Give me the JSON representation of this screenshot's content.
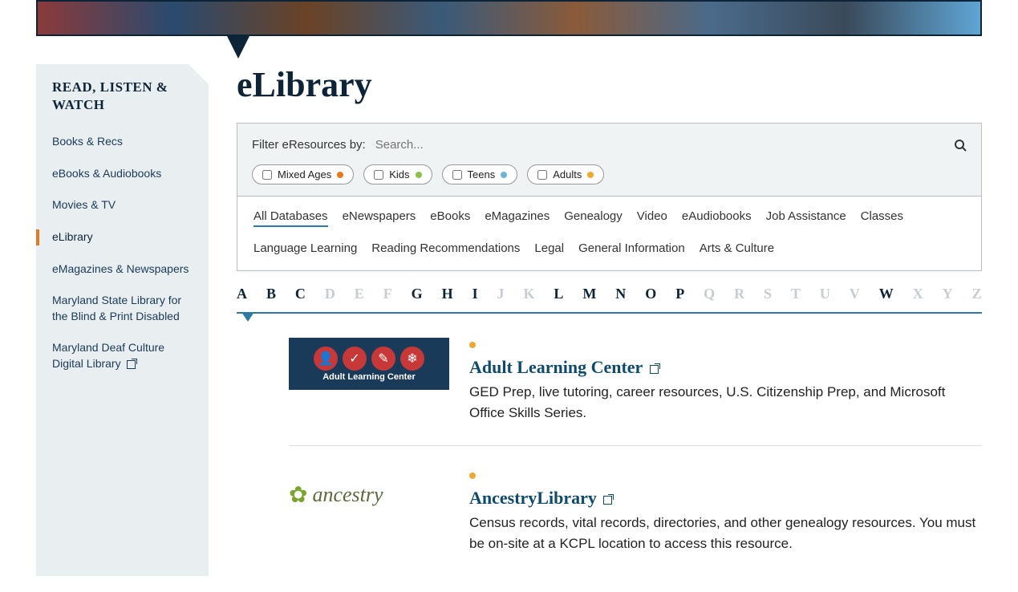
{
  "sidebar": {
    "title": "READ, LISTEN & WATCH",
    "items": [
      {
        "label": "Books & Recs",
        "active": false,
        "external": false
      },
      {
        "label": "eBooks & Audiobooks",
        "active": false,
        "external": false
      },
      {
        "label": "Movies & TV",
        "active": false,
        "external": false
      },
      {
        "label": "eLibrary",
        "active": true,
        "external": false
      },
      {
        "label": "eMagazines & Newspapers",
        "active": false,
        "external": false
      },
      {
        "label": "Maryland State Library for the Blind & Print Disabled",
        "active": false,
        "external": false
      },
      {
        "label": "Maryland Deaf Culture Digital Library",
        "active": false,
        "external": true
      }
    ]
  },
  "page": {
    "title": "eLibrary"
  },
  "filter": {
    "label": "Filter eResources by:",
    "placeholder": "Search...",
    "pills": [
      {
        "label": "Mixed Ages",
        "color": "orange"
      },
      {
        "label": "Kids",
        "color": "green"
      },
      {
        "label": "Teens",
        "color": "blue"
      },
      {
        "label": "Adults",
        "color": "amber"
      }
    ]
  },
  "categories": [
    {
      "label": "All Databases",
      "active": true
    },
    {
      "label": "eNewspapers"
    },
    {
      "label": "eBooks"
    },
    {
      "label": "eMagazines"
    },
    {
      "label": "Genealogy"
    },
    {
      "label": "Video"
    },
    {
      "label": "eAudiobooks"
    },
    {
      "label": "Job Assistance"
    },
    {
      "label": "Classes"
    },
    {
      "label": "Language Learning"
    },
    {
      "label": "Reading Recommendations"
    },
    {
      "label": "Legal"
    },
    {
      "label": "General Information"
    },
    {
      "label": "Arts & Culture"
    }
  ],
  "alphabet": [
    {
      "letter": "A",
      "enabled": true
    },
    {
      "letter": "B",
      "enabled": true
    },
    {
      "letter": "C",
      "enabled": true
    },
    {
      "letter": "D",
      "enabled": false
    },
    {
      "letter": "E",
      "enabled": false
    },
    {
      "letter": "F",
      "enabled": false
    },
    {
      "letter": "G",
      "enabled": true
    },
    {
      "letter": "H",
      "enabled": true
    },
    {
      "letter": "I",
      "enabled": true
    },
    {
      "letter": "J",
      "enabled": false
    },
    {
      "letter": "K",
      "enabled": false
    },
    {
      "letter": "L",
      "enabled": true
    },
    {
      "letter": "M",
      "enabled": true
    },
    {
      "letter": "N",
      "enabled": true
    },
    {
      "letter": "O",
      "enabled": true
    },
    {
      "letter": "P",
      "enabled": true
    },
    {
      "letter": "Q",
      "enabled": false
    },
    {
      "letter": "R",
      "enabled": false
    },
    {
      "letter": "S",
      "enabled": false
    },
    {
      "letter": "T",
      "enabled": false
    },
    {
      "letter": "U",
      "enabled": false
    },
    {
      "letter": "V",
      "enabled": false
    },
    {
      "letter": "W",
      "enabled": true
    },
    {
      "letter": "X",
      "enabled": false
    },
    {
      "letter": "Y",
      "enabled": false
    },
    {
      "letter": "Z",
      "enabled": false
    }
  ],
  "results": [
    {
      "logo_type": "alc",
      "logo_text": "Adult Learning Center",
      "tag_color": "amber",
      "title": "Adult Learning Center",
      "desc": "GED Prep, live tutoring, career resources, U.S. Citizenship Prep, and Microsoft Office Skills Series."
    },
    {
      "logo_type": "ancestry",
      "logo_text": "ancestry",
      "tag_color": "amber",
      "title": "AncestryLibrary",
      "desc": "Census records, vital records, directories, and other genealogy resources. You must be on-site at a KCPL location to access this resource."
    }
  ]
}
